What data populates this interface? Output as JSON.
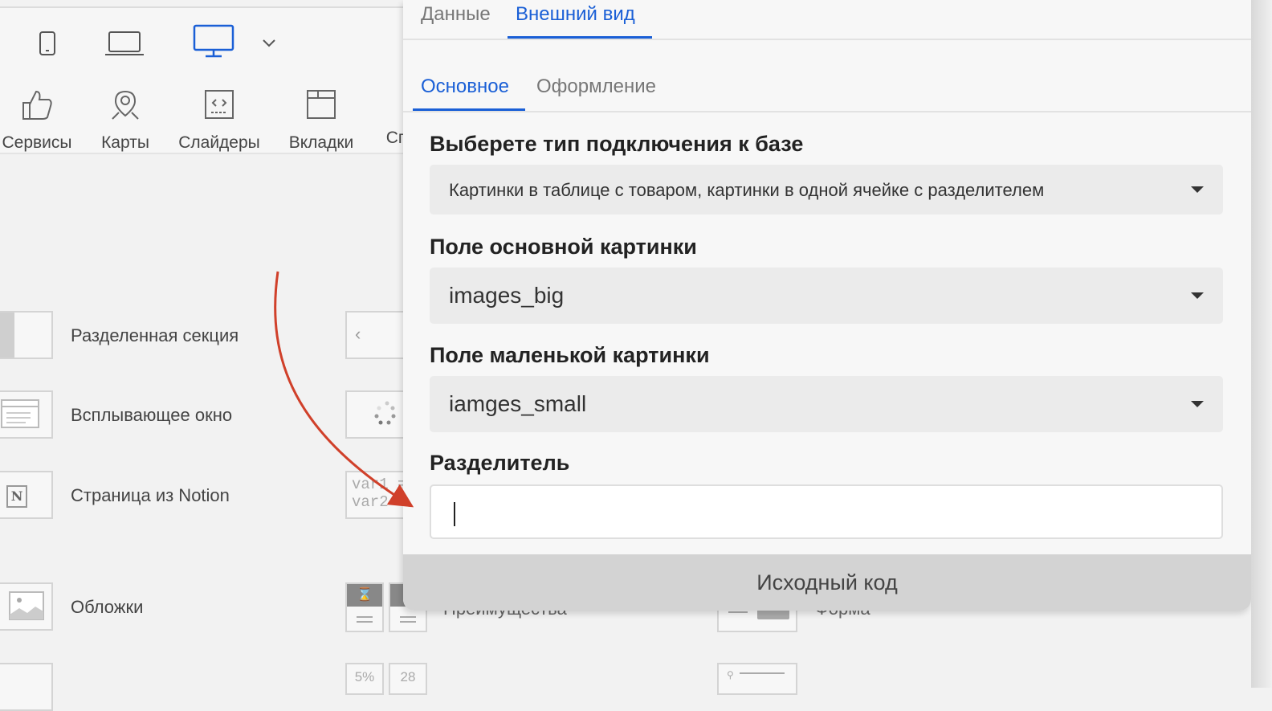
{
  "toolbar": {
    "devices": [
      "mobile-icon",
      "laptop-icon",
      "desktop-icon",
      "chevron-down-icon"
    ],
    "categories": [
      {
        "label": "Сервисы",
        "icon": "thumbs-up-icon"
      },
      {
        "label": "Карты",
        "icon": "map-pin-icon"
      },
      {
        "label": "Слайдеры",
        "icon": "code-slider-icon"
      },
      {
        "label": "Вкладки",
        "icon": "tabs-icon"
      },
      {
        "label": "Сп",
        "icon": ""
      }
    ]
  },
  "blocks": {
    "items": [
      {
        "label": "Разделенная секция",
        "icon": "split-section-icon"
      },
      {
        "label": "Всплывающее окно",
        "icon": "popup-window-icon"
      },
      {
        "label": "Страница из Notion",
        "icon": "notion-icon"
      },
      {
        "label": "Обложки",
        "icon": "cover-image-icon"
      }
    ],
    "mid_text": {
      "v1": "var1 =",
      "v2": "var2",
      "pct": "5%",
      "num": "28"
    },
    "partial_labels": {
      "advantages": "Преимущества",
      "form": "Форма"
    }
  },
  "panel": {
    "top_tabs": [
      {
        "label": "Данные",
        "active": false
      },
      {
        "label": "Внешний вид",
        "active": true
      }
    ],
    "sub_tabs": [
      {
        "label": "Основное",
        "active": true
      },
      {
        "label": "Оформление",
        "active": false
      }
    ],
    "fields": {
      "connection_type": {
        "label": "Выберете тип подключения к базе",
        "value": "Картинки в таблице с товаром, картинки в одной ячейке с разделителем"
      },
      "main_image": {
        "label": "Поле основной картинки",
        "value": "images_big"
      },
      "small_image": {
        "label": "Поле маленькой картинки",
        "value": "iamges_small"
      },
      "separator": {
        "label": "Разделитель",
        "value": ""
      }
    },
    "footer_button": "Исходный код"
  },
  "colors": {
    "accent": "#1a5fd6",
    "arrow": "#d0402a"
  }
}
